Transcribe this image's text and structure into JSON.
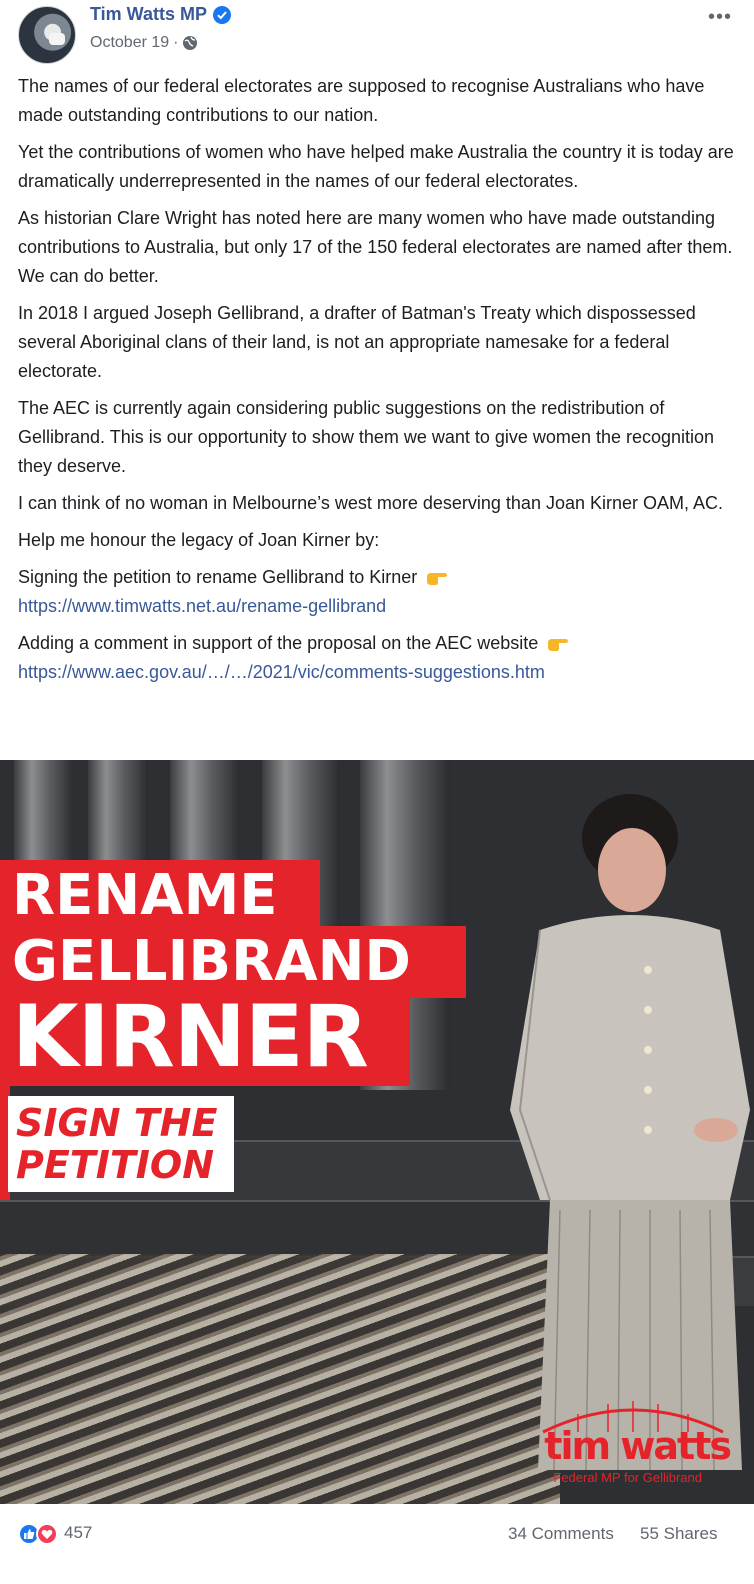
{
  "post": {
    "author": "Tim Watts MP",
    "date": "October 19",
    "date_sep": "·",
    "more_label": "•••",
    "paragraphs": [
      "The names of our federal electorates are supposed to recognise Australians who have made outstanding contributions to our nation.",
      "Yet the contributions of women who have helped make Australia the country it is today are dramatically underrepresented in the names of our federal electorates.",
      "As historian Clare Wright has noted here are many women who have made outstanding contributions to Australia, but only 17 of the 150 federal electorates are named after them. We can do better.",
      "In 2018 I argued Joseph Gellibrand, a drafter of Batman's Treaty which dispossessed several Aboriginal clans of their land, is not an appropriate namesake for a federal electorate.",
      "The AEC is currently again considering public suggestions on the redistribution of Gellibrand. This is our opportunity to show them we want to give women the recognition they deserve.",
      "I can think of no woman in Melbourne’s west more deserving than Joan Kirner OAM, AC.",
      "Help me honour the legacy of Joan Kirner by:"
    ],
    "petition_text": "Signing the petition to rename Gellibrand to Kirner",
    "petition_link": "https://www.timwatts.net.au/rename-gellibrand",
    "aec_text": "Adding a comment in support of the proposal on the AEC website",
    "aec_link": "https://www.aec.gov.au/…/…/2021/vic/comments-suggestions.htm"
  },
  "image": {
    "banner_line1": "RENAME",
    "banner_line2": "GELLIBRAND",
    "banner_line3": "KIRNER",
    "sign_line1": "SIGN THE",
    "sign_line2": "PETITION",
    "logo_name": "tim watts",
    "logo_sub": "Federal MP for Gellibrand"
  },
  "footer": {
    "reactions_count": "457",
    "comments": "34 Comments",
    "shares": "55 Shares"
  },
  "colors": {
    "brand_red": "#e4242a",
    "link_blue": "#385898",
    "like_blue": "#1877f2",
    "love_red": "#f33e58"
  },
  "icons": [
    "verified-icon",
    "globe-icon",
    "more-icon",
    "pointing-hand-icon",
    "like-icon",
    "love-icon"
  ]
}
